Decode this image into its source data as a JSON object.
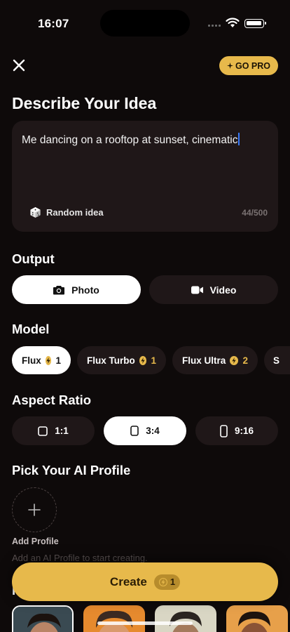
{
  "status": {
    "time": "16:07"
  },
  "header": {
    "pro_label": "GO PRO"
  },
  "prompt": {
    "title": "Describe Your Idea",
    "text": "Me dancing on a rooftop at sunset, cinematic",
    "random_label": "Random idea",
    "char_count": "44/500"
  },
  "output": {
    "label": "Output",
    "options": [
      {
        "label": "Photo",
        "icon": "camera-icon",
        "selected": true
      },
      {
        "label": "Video",
        "icon": "video-icon",
        "selected": false
      }
    ]
  },
  "model": {
    "label": "Model",
    "options": [
      {
        "label": "Flux",
        "cost": "1",
        "selected": true
      },
      {
        "label": "Flux Turbo",
        "cost": "1",
        "selected": false
      },
      {
        "label": "Flux Ultra",
        "cost": "2",
        "selected": false
      },
      {
        "label": "S",
        "cost": "",
        "selected": false
      }
    ]
  },
  "aspect": {
    "label": "Aspect Ratio",
    "options": [
      {
        "label": "1:1",
        "selected": false
      },
      {
        "label": "3:4",
        "selected": true
      },
      {
        "label": "9:16",
        "selected": false
      }
    ]
  },
  "profile": {
    "label": "Pick Your AI Profile",
    "add_label": "Add Profile",
    "hint": "Add an AI Profile to start creating."
  },
  "create": {
    "label": "Create",
    "cost": "1"
  },
  "colors": {
    "accent": "#e7b94b",
    "background": "#0e0a0a",
    "card": "#1f1718"
  }
}
